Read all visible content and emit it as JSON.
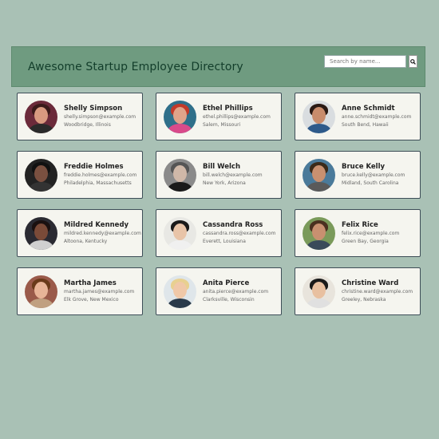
{
  "header": {
    "title": "Awesome Startup Employee Directory",
    "search_placeholder": "Search by name...",
    "search_icon": "search-icon"
  },
  "employees": [
    {
      "name": "Shelly Simpson",
      "email": "shelly.simpson@example.com",
      "location": "Woodbridge, Illinois",
      "avatar": {
        "bg": "#6b2a3a",
        "skin": "#d89a80",
        "hair": "#3a1a1a",
        "shirt": "#2a2a2a"
      }
    },
    {
      "name": "Ethel Phillips",
      "email": "ethel.phillips@example.com",
      "location": "Salem, Missouri",
      "avatar": {
        "bg": "#2f6f8a",
        "skin": "#e0a48a",
        "hair": "#c23a2a",
        "shirt": "#d94a8a"
      }
    },
    {
      "name": "Anne Schmidt",
      "email": "anne.schmidt@example.com",
      "location": "South Bend, Hawaii",
      "avatar": {
        "bg": "#d9dde0",
        "skin": "#c88c6c",
        "hair": "#2a1a14",
        "shirt": "#2e5a8a"
      }
    },
    {
      "name": "Freddie Holmes",
      "email": "freddie.holmes@example.com",
      "location": "Philadelphia, Massachusetts",
      "avatar": {
        "bg": "#222222",
        "skin": "#7a5040",
        "hair": "#111111",
        "shirt": "#333333"
      }
    },
    {
      "name": "Bill Welch",
      "email": "bill.welch@example.com",
      "location": "New York, Arizona",
      "avatar": {
        "bg": "#8a8a8a",
        "skin": "#d0b8a8",
        "hair": "#555555",
        "shirt": "#1a1a1a"
      }
    },
    {
      "name": "Bruce Kelly",
      "email": "bruce.kelly@example.com",
      "location": "Midland, South Carolina",
      "avatar": {
        "bg": "#4a7a9a",
        "skin": "#c89070",
        "hair": "#3a2a1a",
        "shirt": "#5a5a5a"
      }
    },
    {
      "name": "Mildred Kennedy",
      "email": "mildred.kennedy@example.com",
      "location": "Altoona, Kentucky",
      "avatar": {
        "bg": "#2a2a32",
        "skin": "#7a4a38",
        "hair": "#1a1010",
        "shirt": "#d0d0d0"
      }
    },
    {
      "name": "Cassandra Ross",
      "email": "cassandra.ross@example.com",
      "location": "Everett, Louisiana",
      "avatar": {
        "bg": "#e8e8e4",
        "skin": "#e8c4a8",
        "hair": "#1a1a1a",
        "shirt": "#f0f0f0"
      }
    },
    {
      "name": "Felix Rice",
      "email": "felix.rice@example.com",
      "location": "Green Bay, Georgia",
      "avatar": {
        "bg": "#7a9a5a",
        "skin": "#c89070",
        "hair": "#4a3020",
        "shirt": "#3a4a5a"
      }
    },
    {
      "name": "Martha James",
      "email": "martha.james@example.com",
      "location": "Elk Grove, New Mexico",
      "avatar": {
        "bg": "#9a5a4a",
        "skin": "#e8b498",
        "hair": "#6a3a1a",
        "shirt": "#c0a080"
      }
    },
    {
      "name": "Anita Pierce",
      "email": "anita.pierce@example.com",
      "location": "Clarksville, Wisconsin",
      "avatar": {
        "bg": "#dfe6ea",
        "skin": "#f0c8a8",
        "hair": "#e8d090",
        "shirt": "#2a3a4a"
      }
    },
    {
      "name": "Christine Ward",
      "email": "christine.ward@example.com",
      "location": "Greeley, Nebraska",
      "avatar": {
        "bg": "#e8e4dc",
        "skin": "#e8c0a0",
        "hair": "#1a1a1a",
        "shirt": "#e0e0e0"
      }
    }
  ]
}
